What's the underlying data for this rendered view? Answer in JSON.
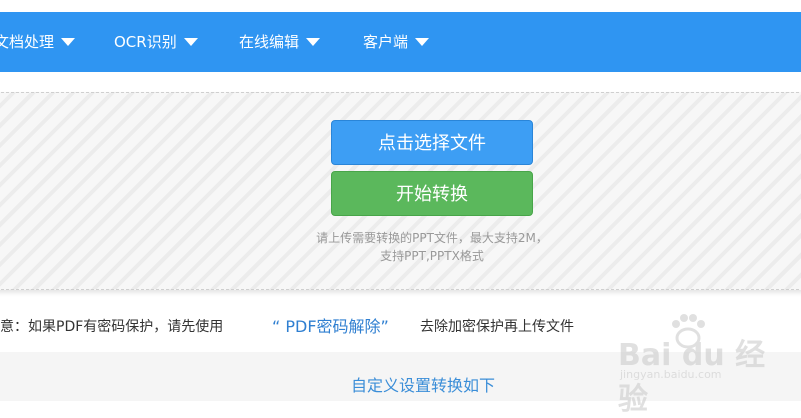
{
  "nav": {
    "items": [
      {
        "label": "文档处理"
      },
      {
        "label": "OCR识别"
      },
      {
        "label": "在线编辑"
      },
      {
        "label": "客户端"
      }
    ]
  },
  "upload": {
    "select_label": "点击选择文件",
    "start_label": "开始转换",
    "hint_line1": "请上传需要转换的PPT文件，最大支持2M，",
    "hint_line2": "支持PPT,PPTX格式"
  },
  "notice": {
    "prefix": "意：如果PDF有密码保护，请先使用",
    "link": "“ PDF密码解除”",
    "suffix": "去除加密保护再上传文件"
  },
  "settings": {
    "title": "自定义设置转换如下"
  },
  "watermark": {
    "brand": "Bai du 经验",
    "url": "jingyan.baidu.com"
  },
  "colors": {
    "nav_bg": "#2f95f2",
    "select_button": "#3d9ef4",
    "start_button": "#5bb85c",
    "link": "#2f7fd1"
  }
}
